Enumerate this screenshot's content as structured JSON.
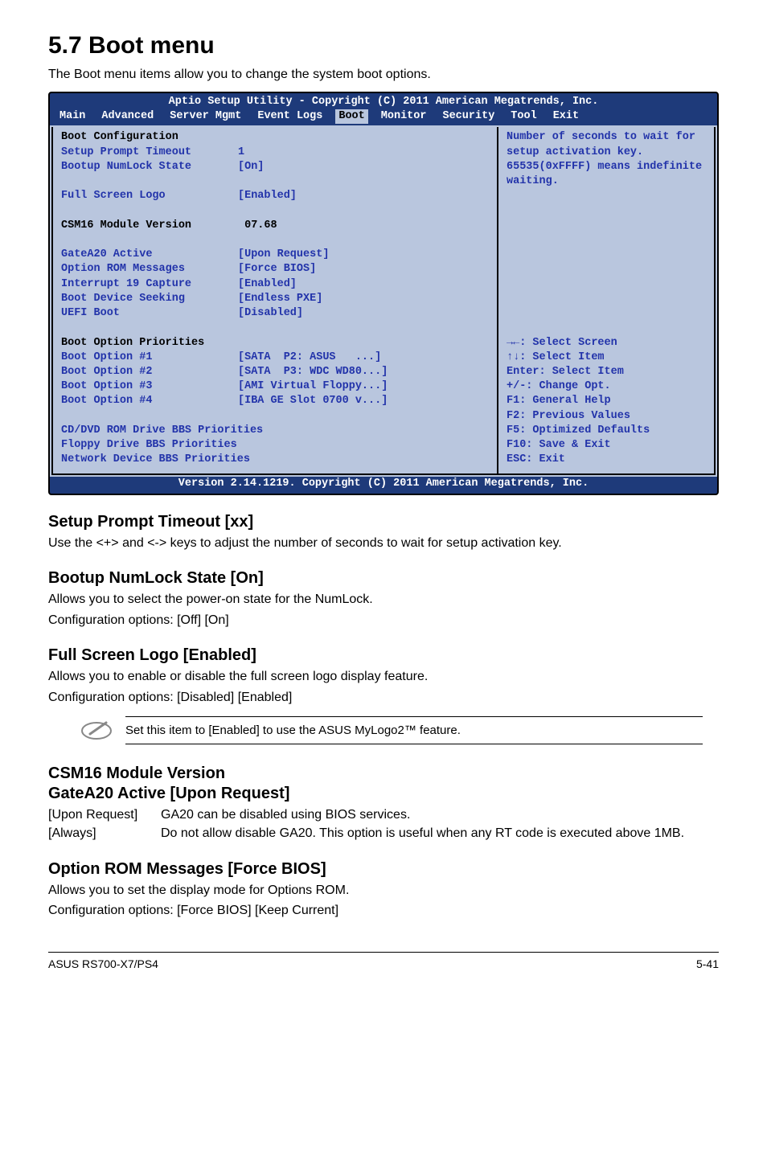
{
  "heading": "5.7    Boot menu",
  "intro": "The Boot menu items allow you to change the system boot options.",
  "bios": {
    "title": "Aptio Setup Utility - Copyright (C) 2011 American Megatrends, Inc.",
    "tabs": [
      "Main",
      "Advanced",
      "Server Mgmt",
      "Event Logs",
      "Boot",
      "Monitor",
      "Security",
      "Tool",
      "Exit"
    ],
    "active_tab": "Boot",
    "left_groups": {
      "config_header": "Boot Configuration",
      "rows1": [
        {
          "label": "Setup Prompt Timeout",
          "value": "1",
          "blue": true
        },
        {
          "label": "Bootup NumLock State",
          "value": "[On]",
          "blue": true
        }
      ],
      "rows2": [
        {
          "label": "Full Screen Logo",
          "value": "[Enabled]",
          "blue": true
        }
      ],
      "rows3": [
        {
          "label": "CSM16 Module Version",
          "value": " 07.68",
          "blue": false
        }
      ],
      "rows4": [
        {
          "label": "GateA20 Active",
          "value": "[Upon Request]",
          "blue": true
        },
        {
          "label": "Option ROM Messages",
          "value": "[Force BIOS]",
          "blue": true
        },
        {
          "label": "Interrupt 19 Capture",
          "value": "[Enabled]",
          "blue": true
        },
        {
          "label": "Boot Device Seeking",
          "value": "[Endless PXE]",
          "blue": true
        },
        {
          "label": "UEFI Boot",
          "value": "[Disabled]",
          "blue": true
        }
      ],
      "priorities_header": "Boot Option Priorities",
      "rows5": [
        {
          "label": "Boot Option #1",
          "value": "[SATA  P2: ASUS   ...]",
          "blue": true
        },
        {
          "label": "Boot Option #2",
          "value": "[SATA  P3: WDC WD80...]",
          "blue": true
        },
        {
          "label": "Boot Option #3",
          "value": "[AMI Virtual Floppy...]",
          "blue": true
        },
        {
          "label": "Boot Option #4",
          "value": "[IBA GE Slot 0700 v...]",
          "blue": true
        }
      ],
      "rows6": [
        {
          "label": "CD/DVD ROM Drive BBS Priorities",
          "value": "",
          "blue": true
        },
        {
          "label": "Floppy Drive BBS Priorities",
          "value": "",
          "blue": true
        },
        {
          "label": "Network Device BBS Priorities",
          "value": "",
          "blue": true
        }
      ]
    },
    "help_top": "Number of seconds to wait for setup activation key. 65535(0xFFFF) means indefinite waiting.",
    "help_nav": [
      "→←: Select Screen",
      "↑↓:  Select Item",
      "Enter: Select Item",
      "+/-: Change Opt.",
      "F1: General Help",
      "F2: Previous Values",
      "F5: Optimized Defaults",
      "F10: Save & Exit",
      "ESC: Exit"
    ],
    "version": "Version 2.14.1219. Copyright (C)  2011 American Megatrends, Inc."
  },
  "sec1": {
    "head": "Setup Prompt Timeout [xx]",
    "body": "Use the <+> and <-> keys to adjust the number of seconds to wait for setup activation key."
  },
  "sec2": {
    "head": "Bootup NumLock State [On]",
    "body1": "Allows you to select the power-on state for the NumLock.",
    "body2": "Configuration options: [Off] [On]"
  },
  "sec3": {
    "head": "Full Screen Logo [Enabled]",
    "body1": "Allows you to enable or disable the full screen logo display feature.",
    "body2": "Configuration options: [Disabled] [Enabled]"
  },
  "note": "Set this item to [Enabled] to use the ASUS MyLogo2™ feature.",
  "sec4a": {
    "head": "CSM16 Module Version"
  },
  "sec4b": {
    "head": "GateA20 Active [Upon Request]",
    "row1_term": "[Upon Request]",
    "row1_desc": "GA20 can be disabled using BIOS services.",
    "row2_term": "[Always]",
    "row2_desc": "Do not allow disable GA20. This option is useful when any RT code is executed above 1MB."
  },
  "sec5": {
    "head": "Option ROM Messages [Force BIOS]",
    "body1": "Allows you to set the display mode for Options ROM.",
    "body2": "Configuration options: [Force BIOS] [Keep Current]"
  },
  "footer": {
    "left": "ASUS RS700-X7/PS4",
    "right": "5-41"
  }
}
